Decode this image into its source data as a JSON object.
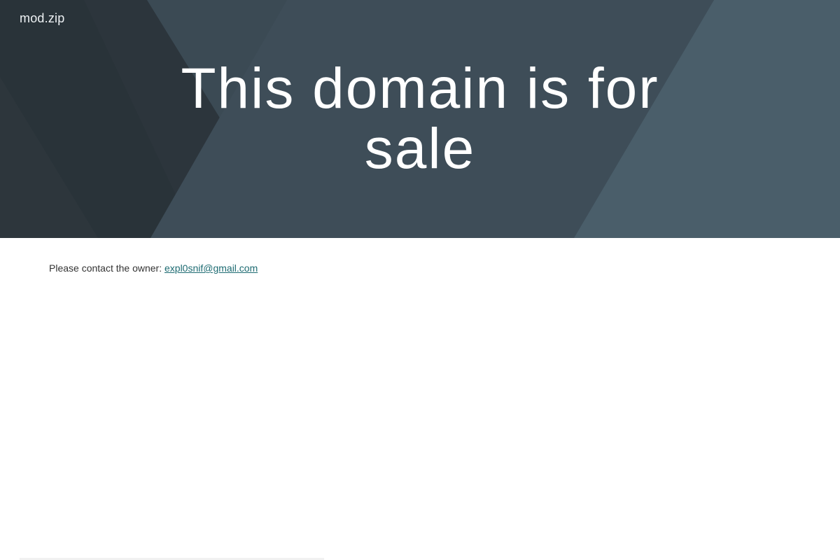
{
  "header": {
    "site_name": "mod.zip"
  },
  "hero": {
    "headline": "This domain is for sale"
  },
  "contact": {
    "label": "Please contact the owner:",
    "email": "expl0snif@gmail.com",
    "email_href": "mailto:expl0snif@gmail.com"
  },
  "colors": {
    "hero_background": "#3a4a55",
    "link": "#1d6b72",
    "body_text": "#333333"
  }
}
